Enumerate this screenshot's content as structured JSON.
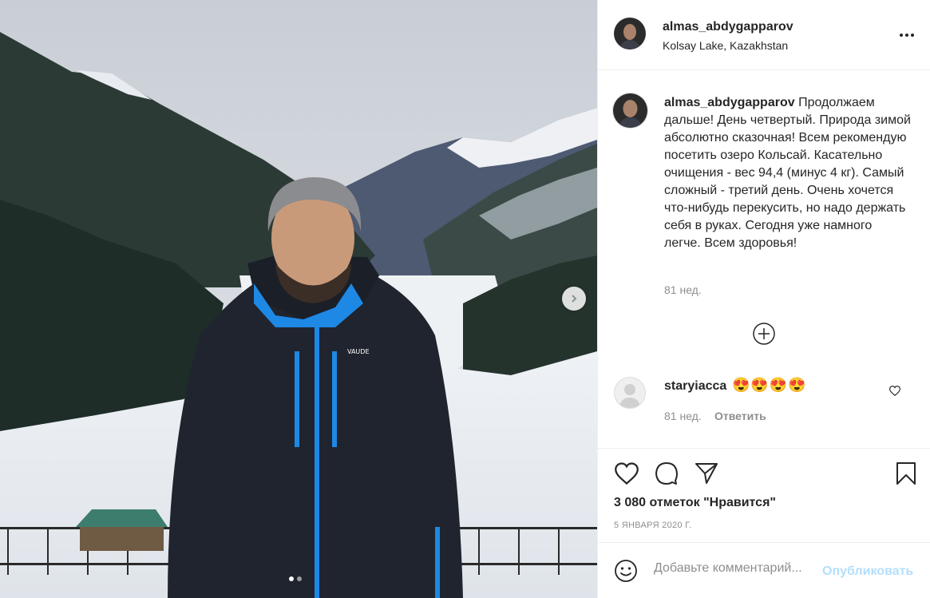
{
  "post": {
    "username": "almas_abdygapparov",
    "location": "Kolsay Lake, Kazakhstan",
    "more_icon": "more-horizontal-icon"
  },
  "photo": {
    "carousel_total": 2,
    "carousel_index": 1,
    "next_icon": "chevron-right-icon"
  },
  "caption": {
    "username": "almas_abdygapparov",
    "text": "Продолжаем дальше! День четвертый. Природа зимой абсолютно сказочная! Всем рекомендую посетить озеро Кольсай. Касательно очищения - вес 94,4 (минус 4 кг). Самый сложный - третий день. Очень хочется что-нибудь перекусить, но надо держать себя в руках. Сегодня уже намного легче. Всем здоровья!",
    "time": "81 нед.",
    "load_more_icon": "plus-circle-icon"
  },
  "comments": [
    {
      "username": "staryiacca",
      "text": "😍😍😍😍",
      "time": "81 нед.",
      "reply_label": "Ответить",
      "like_icon": "heart-outline-icon"
    }
  ],
  "actions": {
    "like_icon": "heart-outline-icon",
    "comment_icon": "comment-bubble-icon",
    "share_icon": "paper-plane-icon",
    "save_icon": "bookmark-icon"
  },
  "likes_text": "3 080 отметок \"Нравится\"",
  "date": "5 ЯНВАРЯ 2020 Г.",
  "add_comment": {
    "emoji_icon": "smiley-icon",
    "placeholder": "Добавьте комментарий...",
    "post_label": "Опубликовать"
  },
  "colors": {
    "text": "#262626",
    "muted": "#8e8e8e",
    "border": "#efefef",
    "post_disabled": "#b2dffc"
  }
}
